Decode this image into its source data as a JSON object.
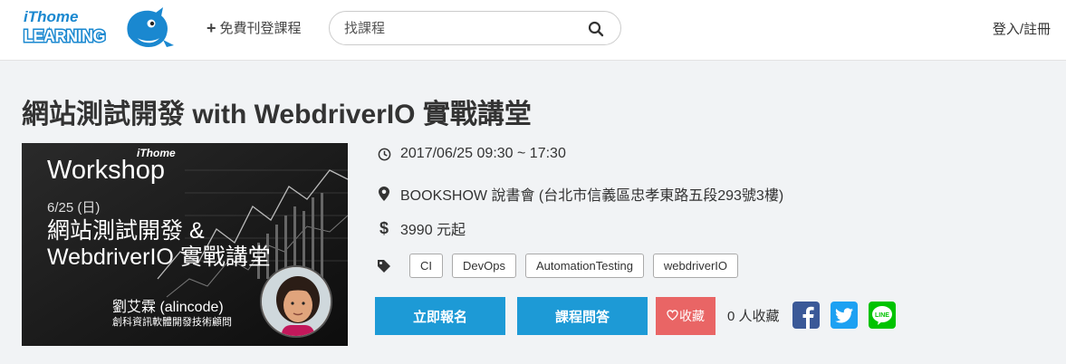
{
  "header": {
    "logo_text_top": "iThome",
    "logo_text_bottom": "LEARNING",
    "post_course": "免費刊登課程",
    "search_placeholder": "找課程",
    "login": "登入/註冊"
  },
  "course": {
    "title": "網站測試開發 with WebdriverIO 實戰講堂",
    "datetime": "2017/06/25 09:30 ~ 17:30",
    "location": "BOOKSHOW 說書會 (台北市信義區忠孝東路五段293號3樓)",
    "price": "3990 元起",
    "tags": [
      "CI",
      "DevOps",
      "AutomationTesting",
      "webdriverIO"
    ]
  },
  "banner": {
    "brand": "iThome",
    "workshop": "Workshop",
    "date": "6/25 (日)",
    "line1": "網站測試開發 &",
    "line2": "WebdriverIO 實戰講堂",
    "speaker": "劉艾霖 (alincode)",
    "role": "創科資訊軟體開發技術顧問"
  },
  "actions": {
    "signup": "立即報名",
    "qa": "課程問答",
    "favorite": "收藏",
    "favorite_count": "0 人收藏"
  },
  "colors": {
    "primary": "#1d9ad6",
    "favorite": "#e96565",
    "facebook": "#3b5998",
    "twitter": "#1da1f2",
    "line": "#00c300"
  }
}
